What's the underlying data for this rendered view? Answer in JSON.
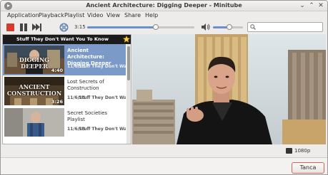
{
  "window": {
    "title": "Ancient Architecture: Digging Deeper - Minitube"
  },
  "menu": {
    "items": [
      {
        "label": "Application"
      },
      {
        "label": "Playback"
      },
      {
        "label": "Playlist"
      },
      {
        "label": "Video"
      },
      {
        "label": "View"
      },
      {
        "label": "Share"
      },
      {
        "label": "Help"
      }
    ]
  },
  "toolbar": {
    "elapsed_time": "3:15",
    "seek_fraction": 0.64,
    "volume_fraction": 0.55,
    "search": {
      "value": "",
      "placeholder": ""
    }
  },
  "playlist": {
    "header": "Stuff They Don't Want You To Know",
    "items": [
      {
        "title": "Ancient Architecture: Digging Deeper",
        "date": "11/6/13",
        "author": "Stuff They Don't Want",
        "duration": "4:40",
        "thumb_text": "DIGGING DEEPER",
        "selected": true
      },
      {
        "title": "Lost Secrets of Construction",
        "date": "11/6/13",
        "author": "Stuff They Don't Want",
        "duration": "3:26",
        "thumb_text": "ANCIENT CONSTRUCTION",
        "selected": false
      },
      {
        "title": "Secret Societies Playlist",
        "date": "11/6/13",
        "author": "Stuff They Don't Want",
        "duration": "",
        "thumb_text": "",
        "selected": false
      }
    ]
  },
  "status": {
    "quality": "1080p"
  },
  "buttons": {
    "close": "Tanca"
  },
  "colors": {
    "selection": "#7c9ac7",
    "accent": "#6a8fcf",
    "stop": "#d43b2d",
    "close_border": "#d4644e"
  }
}
